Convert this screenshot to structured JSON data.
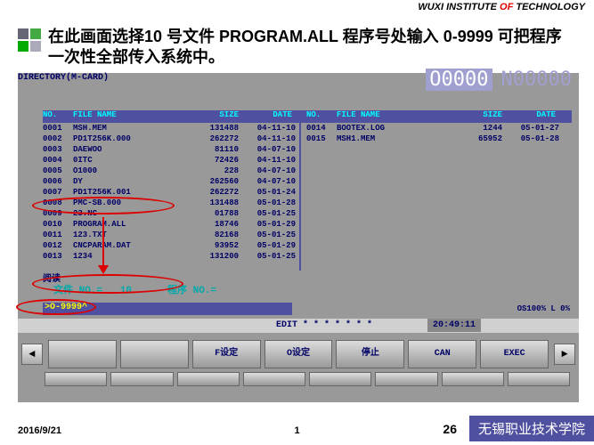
{
  "institute": {
    "w": "WUXI",
    "i": "INSTITUTE",
    "of": "OF",
    "t": "TECHNOLOGY"
  },
  "title": "在此画面选择10 号文件 PROGRAM.ALL 程序号处输入 0-9999 可把程序一次性全部传入系统中。",
  "dirTitle": "DIRECTORY(M-CARD)",
  "bigO": "O0000",
  "bigN": "N00000",
  "headers": {
    "no": "NO.",
    "name": "FILE NAME",
    "size": "SIZE",
    "date": "DATE"
  },
  "filesLeft": [
    {
      "no": "0001",
      "name": "MSH.MEM",
      "size": "131488",
      "date": "04-11-10"
    },
    {
      "no": "0002",
      "name": "PD1T256K.000",
      "size": "262272",
      "date": "04-11-10"
    },
    {
      "no": "0003",
      "name": "DAEWOO",
      "size": "81110",
      "date": "04-07-10"
    },
    {
      "no": "0004",
      "name": "0ITC",
      "size": "72426",
      "date": "04-11-10"
    },
    {
      "no": "0005",
      "name": "O1000",
      "size": "228",
      "date": "04-07-10"
    },
    {
      "no": "0006",
      "name": "DY",
      "size": "262560",
      "date": "04-07-10"
    },
    {
      "no": "0007",
      "name": "PD1T256K.001",
      "size": "262272",
      "date": "05-01-24"
    },
    {
      "no": "0008",
      "name": "PMC-SB.000",
      "size": "131488",
      "date": "05-01-28"
    },
    {
      "no": "0009",
      "name": "23.NC",
      "size": "01788",
      "date": "05-01-25"
    },
    {
      "no": "0010",
      "name": "PROGRAM.ALL",
      "size": "18746",
      "date": "05-01-29"
    },
    {
      "no": "0011",
      "name": "123.TXT",
      "size": "82168",
      "date": "05-01-25"
    },
    {
      "no": "0012",
      "name": "CNCPARAM.DAT",
      "size": "93952",
      "date": "05-01-29"
    },
    {
      "no": "0013",
      "name": "1234",
      "size": "131200",
      "date": "05-01-25"
    }
  ],
  "filesRight": [
    {
      "no": "0014",
      "name": "BOOTEX.LOG",
      "size": "1244",
      "date": "05-01-27"
    },
    {
      "no": "0015",
      "name": "MSH1.MEM",
      "size": "65952",
      "date": "05-01-28"
    }
  ],
  "yuesu": "阅读",
  "fileNo": {
    "label1": "文件 NO.=",
    "val1": "10",
    "label2": "程序 NO.="
  },
  "input": ">O-9999^",
  "osStatus": "OS100% L  0%",
  "edit": "EDIT * * * * * * *",
  "time": "20:49:11",
  "softkeys": {
    "arrL": "◄",
    "arrR": "►",
    "k1": "",
    "k2": "",
    "k3": "F设定",
    "k4": "O设定",
    "k5": "停止",
    "k6": "CAN",
    "k7": "EXEC"
  },
  "footer": {
    "date": "2016/9/21",
    "page1": "1",
    "page2": "26",
    "school": "无锡职业技术学院"
  }
}
